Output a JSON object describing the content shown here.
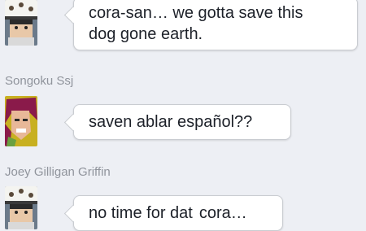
{
  "messages": [
    {
      "sender": "",
      "avatar_icon": "law-white-hat-avatar",
      "lines": [
        "cora-san… we gotta save this",
        "dog gone earth."
      ]
    },
    {
      "sender": "Songoku Ssj",
      "avatar_icon": "red-hair-character-avatar",
      "lines": [
        "saven ablar español??"
      ]
    },
    {
      "sender": "Joey Gilligan Griffin",
      "avatar_icon": "law-white-hat-avatar",
      "text_main": "no time for dat",
      "text_chip": "cora…"
    }
  ],
  "colors": {
    "page_bg": "#edeff4",
    "bubble_bg": "#ffffff",
    "bubble_border": "#c9ccd1",
    "sender_name": "#90949c",
    "message_text": "#1d2129"
  }
}
